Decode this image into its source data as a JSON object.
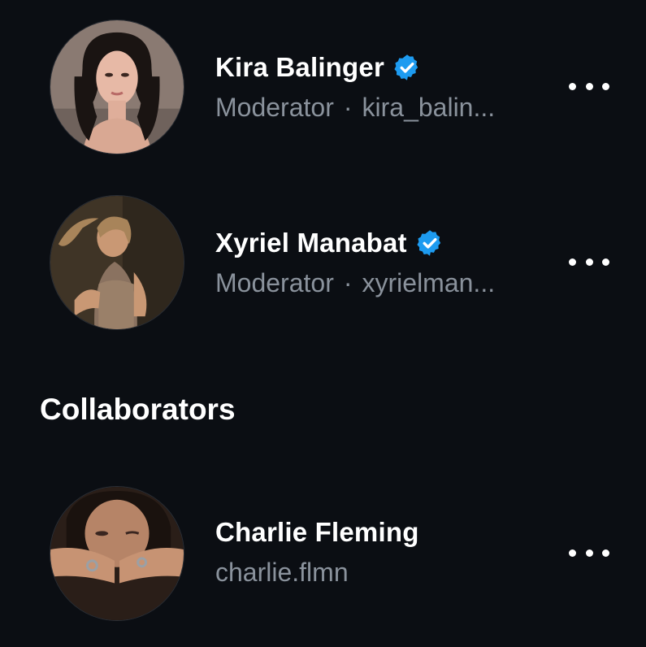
{
  "moderators": [
    {
      "name": "Kira Balinger",
      "verified": true,
      "role": "Moderator",
      "separator": "·",
      "handle": "kira_balin..."
    },
    {
      "name": "Xyriel Manabat",
      "verified": true,
      "role": "Moderator",
      "separator": "·",
      "handle": "xyrielman..."
    }
  ],
  "collaborators_section": {
    "title": "Collaborators",
    "items": [
      {
        "name": "Charlie Fleming",
        "verified": false,
        "handle": "charlie.flmn"
      }
    ]
  },
  "icons": {
    "verified": "verified-badge-icon",
    "more": "more-options-icon"
  },
  "colors": {
    "background": "#0b0e13",
    "name_text": "#ffffff",
    "secondary_text": "#8a929c",
    "verified_blue": "#1d9bf0"
  }
}
